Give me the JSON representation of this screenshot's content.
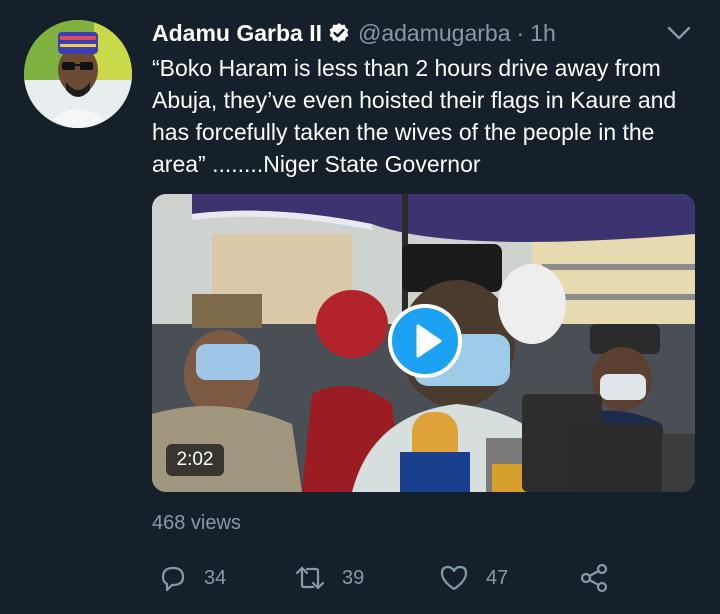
{
  "tweet": {
    "author_name": "Adamu Garba II",
    "handle": "@adamugarba",
    "separator": "·",
    "time": "1h",
    "text": "“Boko Haram is less than 2 hours drive away from Abuja, they’ve even hoisted their flags in Kaure and has forcefully taken the wives of the people in the area” ........Niger State Governor",
    "media": {
      "duration": "2:02",
      "play_icon": "play-icon"
    },
    "views": "468 views",
    "actions": {
      "reply_count": "34",
      "retweet_count": "39",
      "like_count": "47"
    }
  },
  "colors": {
    "background": "#15202b",
    "text_primary": "#ffffff",
    "text_secondary": "#8899a6",
    "accent": "#1da1f2"
  }
}
